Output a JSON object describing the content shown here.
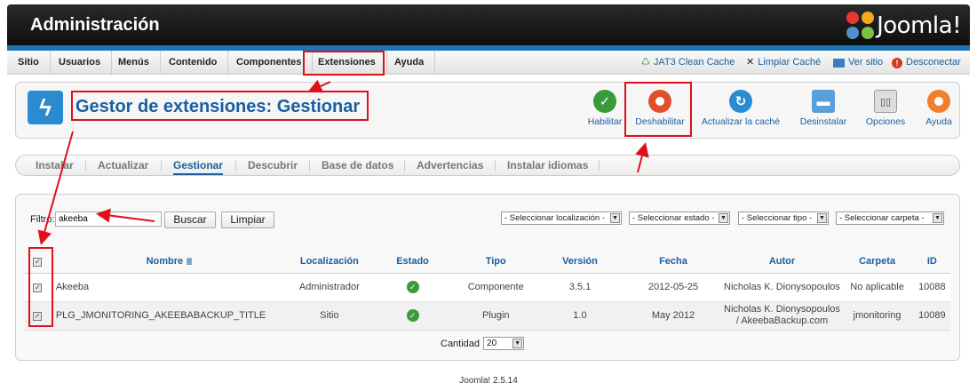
{
  "header": {
    "title": "Administración",
    "logo_text": "Joomla!"
  },
  "menu": [
    "Sitio",
    "Usuarios",
    "Menús",
    "Contenido",
    "Componentes",
    "Extensiones",
    "Ayuda"
  ],
  "status": {
    "cache": "JAT3 Clean Cache",
    "clear_cache": "Limpiar Caché",
    "view_site": "Ver sitio",
    "logout": "Desconectar"
  },
  "page": {
    "title": "Gestor de extensiones: Gestionar"
  },
  "toolbar": {
    "enable": "Habilitar",
    "disable": "Deshabilitar",
    "refresh_cache": "Actualizar la caché",
    "uninstall": "Desinstalar",
    "options": "Opciones",
    "help": "Ayuda"
  },
  "tabs": [
    "Instalar",
    "Actualizar",
    "Gestionar",
    "Descubrir",
    "Base de datos",
    "Advertencias",
    "Instalar idiomas"
  ],
  "filter": {
    "label": "Filtro:",
    "value": "akeeba",
    "search_button": "Buscar",
    "clear_button": "Limpiar",
    "select_location": "- Seleccionar localización -",
    "select_state": "- Seleccionar estado -",
    "select_type": "- Seleccionar tipo -",
    "select_folder": "- Seleccionar carpeta -"
  },
  "table": {
    "headers": [
      "Nombre",
      "Localización",
      "Estado",
      "Tipo",
      "Versión",
      "Fecha",
      "Autor",
      "Carpeta",
      "ID"
    ],
    "rows": [
      {
        "name": "Akeeba",
        "location": "Administrador",
        "type": "Componente",
        "version": "3.5.1",
        "date": "2012-05-25",
        "author": "Nicholas K. Dionysopoulos",
        "folder": "No aplicable",
        "id": "10088"
      },
      {
        "name": "PLG_JMONITORING_AKEEBABACKUP_TITLE",
        "location": "Sitio",
        "type": "Plugin",
        "version": "1.0",
        "date": "May 2012",
        "author": "Nicholas K. Dionysopoulos / AkeebaBackup.com",
        "folder": "jmonitoring",
        "id": "10089"
      }
    ]
  },
  "pager": {
    "label": "Cantidad",
    "value": "20"
  },
  "footer": "Joomla! 2.5.14",
  "colors": {
    "accent": "#1a5fa0",
    "annotation": "#e0101a"
  }
}
